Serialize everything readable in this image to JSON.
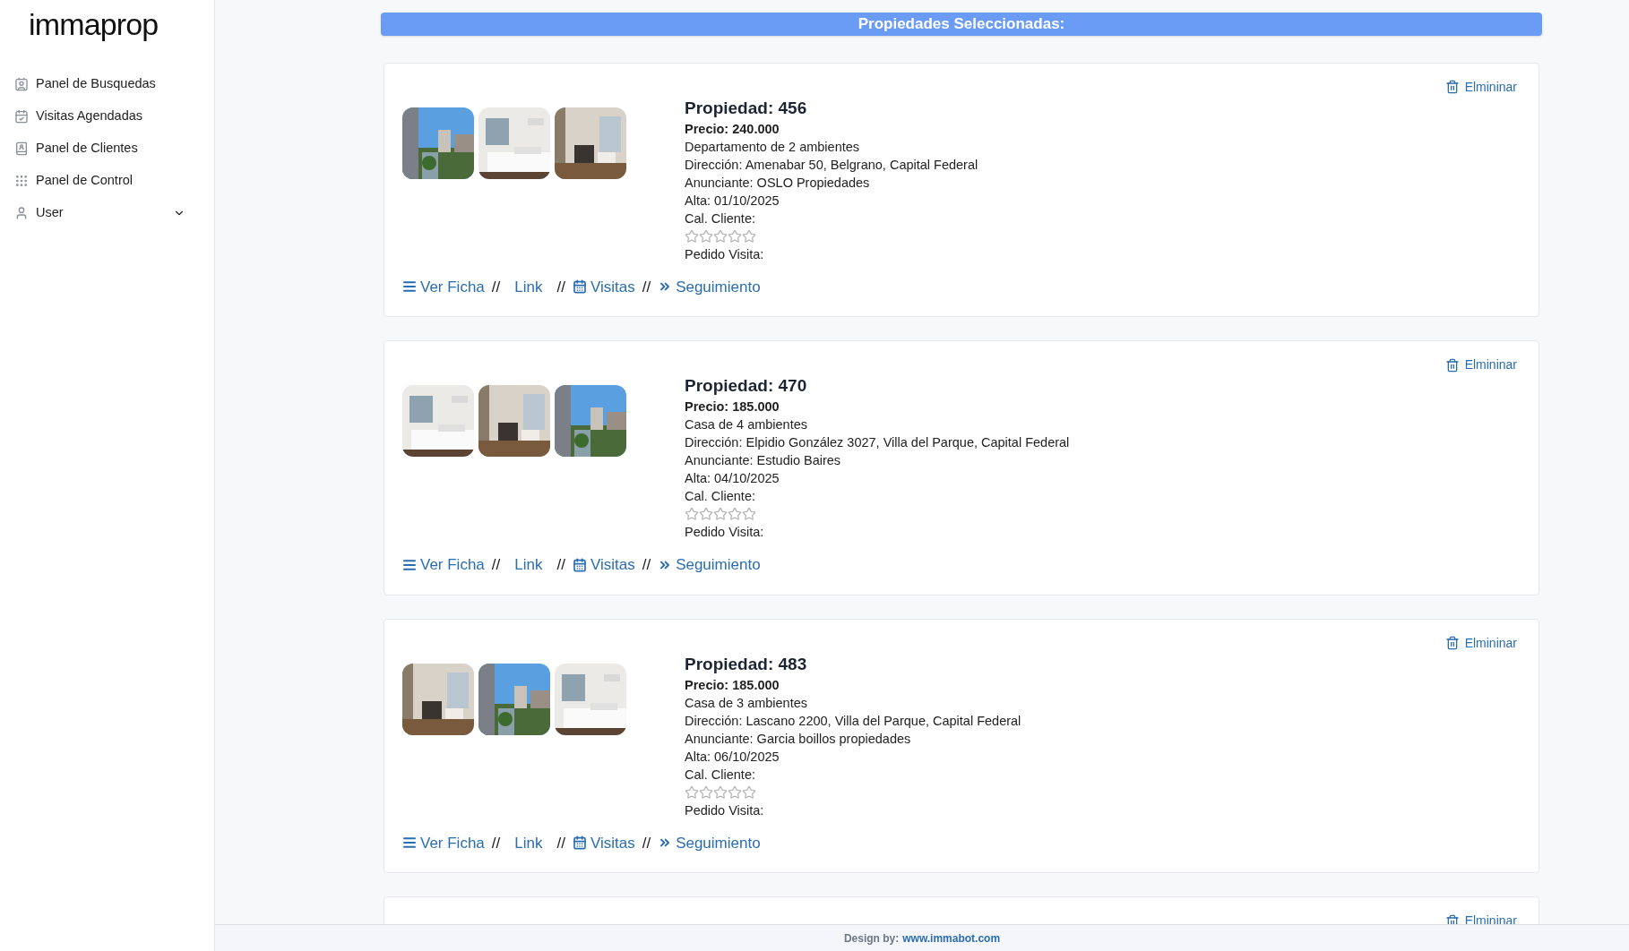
{
  "logo": "immaprop",
  "sidebar": {
    "items": [
      {
        "label": "Panel de Busquedas"
      },
      {
        "label": "Visitas Agendadas"
      },
      {
        "label": "Panel de Clientes"
      },
      {
        "label": "Panel de Control"
      },
      {
        "label": "User",
        "expanded": false
      }
    ]
  },
  "banner": "Propiedades Seleccionadas:",
  "properties": [
    {
      "delete": "Elmininar",
      "title": "Propiedad: 456",
      "price": "Precio: 240.000",
      "type": "Departamento de 2 ambientes",
      "address": "Dirección: Amenabar 50, Belgrano, Capital Federal",
      "advertiser": "Anunciante: OSLO Propiedades",
      "date": "Alta: 01/10/2025",
      "rating_label": "Cal. Cliente:",
      "stars": 0,
      "visit_label": "Pedido Visita:",
      "links": [
        {
          "kind": "list",
          "label": "Ver Ficha"
        },
        {
          "kind": "plain",
          "label": "Link"
        },
        {
          "kind": "calendar",
          "label": "Visitas"
        },
        {
          "kind": "chevrons",
          "label": "Seguimiento"
        }
      ],
      "separator": "//"
    },
    {
      "delete": "Elmininar",
      "title": "Propiedad: 470",
      "price": "Precio: 185.000",
      "type": "Casa de 4 ambientes",
      "address": "Dirección: Elpidio González 3027, Villa del Parque, Capital Federal",
      "advertiser": "Anunciante: Estudio Baires",
      "date": "Alta: 04/10/2025",
      "rating_label": "Cal. Cliente:",
      "stars": 0,
      "visit_label": "Pedido Visita:",
      "links": [
        {
          "kind": "list",
          "label": "Ver Ficha"
        },
        {
          "kind": "plain",
          "label": "Link"
        },
        {
          "kind": "calendar",
          "label": "Visitas"
        },
        {
          "kind": "chevrons",
          "label": "Seguimiento"
        }
      ],
      "separator": "//"
    },
    {
      "delete": "Elmininar",
      "title": "Propiedad: 483",
      "price": "Precio: 185.000",
      "type": "Casa de 3 ambientes",
      "address": "Dirección: Lascano 2200, Villa del Parque, Capital Federal",
      "advertiser": "Anunciante: Garcia boillos propiedades",
      "date": "Alta: 06/10/2025",
      "rating_label": "Cal. Cliente:",
      "stars": 0,
      "visit_label": "Pedido Visita:",
      "links": [
        {
          "kind": "list",
          "label": "Ver Ficha"
        },
        {
          "kind": "plain",
          "label": "Link"
        },
        {
          "kind": "calendar",
          "label": "Visitas"
        },
        {
          "kind": "chevrons",
          "label": "Seguimiento"
        }
      ],
      "separator": "//"
    },
    {
      "delete": "Elmininar"
    }
  ],
  "footer": {
    "label": "Design by:",
    "link": "www.immabot.com"
  }
}
